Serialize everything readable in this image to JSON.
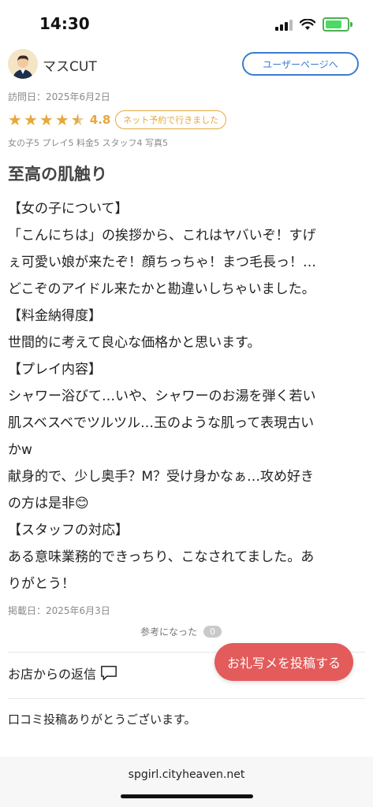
{
  "status_bar": {
    "time": "14:30"
  },
  "reviewer": {
    "name": "マスCUT",
    "user_page_label": "ユーザーページへ"
  },
  "visit": {
    "date_text": "訪問日：2025年6月2日"
  },
  "rating": {
    "value": "4.8",
    "stars": 4.5,
    "reserve_badge": "ネット予約で行きました"
  },
  "sub_scores": "女の子5 プレイ5 料金5 スタッフ4 写真5",
  "review": {
    "title": "至高の肌触り",
    "lines": [
      "【女の子について】",
      "「こんにちは」の挨拶から、これはヤバいぞ！すげ",
      "ぇ可愛い娘が来たぞ！顔ちっちゃ！まつ毛長っ！…",
      "どこぞのアイドル来たかと勘違いしちゃいました。",
      "【料金納得度】",
      "世間的に考えて良心な価格かと思います。",
      "【プレイ内容】",
      "シャワー浴びて…いや、シャワーのお湯を弾く若い",
      "肌スベスベでツルツル…玉のような肌って表現古い",
      "かw",
      "献身的で、少し奥手？M？受け身かなぁ…攻め好き",
      "の方は是非😊",
      "【スタッフの対応】",
      "ある意味業務的できっちり、こなされてました。あ",
      "りがとう！"
    ]
  },
  "posted": {
    "date_text": "掲載日：2025年6月3日"
  },
  "helpful": {
    "label": "参考になった",
    "count": "0"
  },
  "reply": {
    "label": "お店からの返信",
    "text": "口コミ投稿ありがとうございます。"
  },
  "post_photo_button": "お礼写メを投稿する",
  "browser": {
    "url": "spgirl.cityheaven.net"
  },
  "colors": {
    "accent_blue": "#3d7bd1",
    "star_orange": "#e6a83c",
    "cta_red": "#e35b5b"
  }
}
